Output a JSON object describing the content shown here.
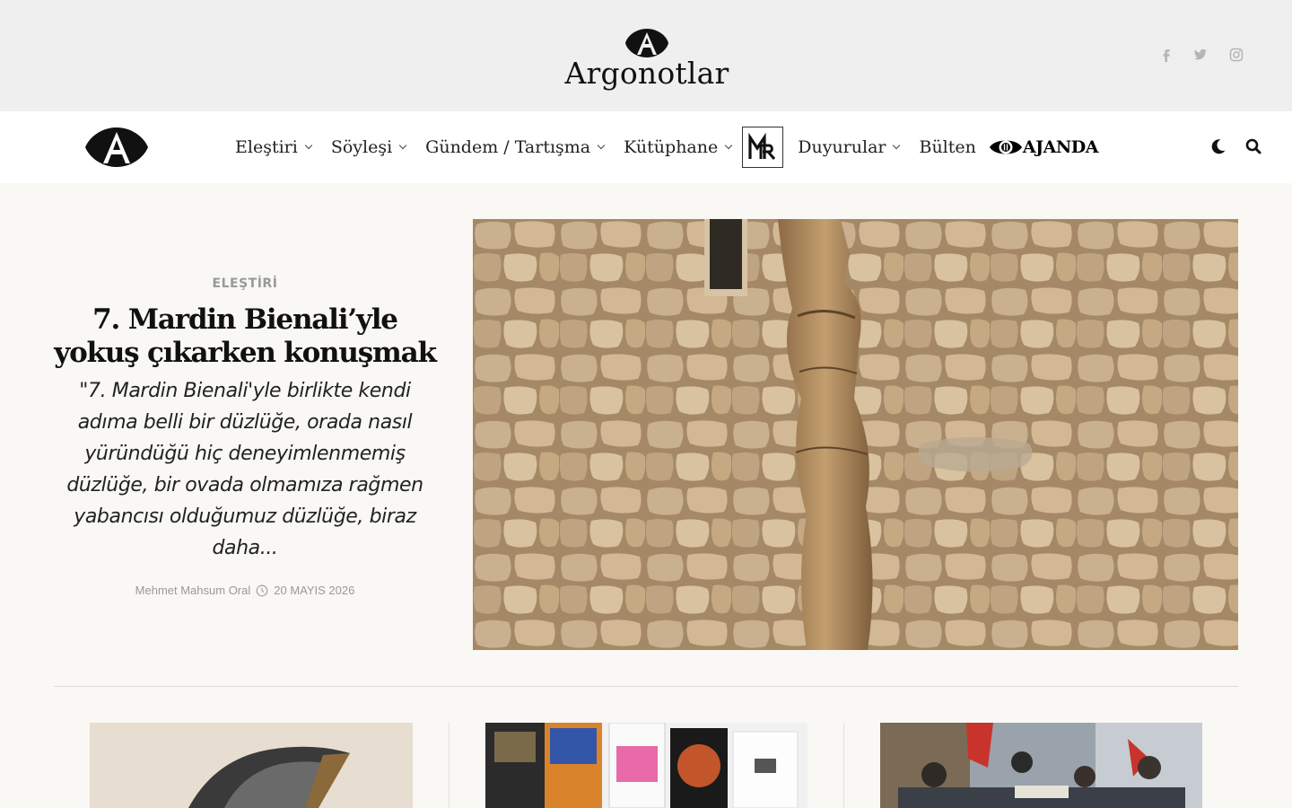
{
  "site": {
    "brand_name": "Argonotlar",
    "social": [
      "facebook-icon",
      "twitter-icon",
      "instagram-icon"
    ]
  },
  "nav": {
    "items": [
      {
        "label": "Eleştiri",
        "dropdown": true
      },
      {
        "label": "Söyleşi",
        "dropdown": true
      },
      {
        "label": "Gündem / Tartışma",
        "dropdown": true
      },
      {
        "label": "Kütüphane",
        "dropdown": true
      },
      {
        "label": "Duyurular",
        "dropdown": true
      },
      {
        "label": "Bülten",
        "dropdown": false
      }
    ],
    "ajanda_label": "AJANDA",
    "right_icons": [
      "moon-icon",
      "search-icon"
    ]
  },
  "hero": {
    "category": "ELEŞTİRİ",
    "title": "7. Mardin Bienali’yle yokuş çıkarken konuşmak",
    "excerpt": "\"7. Mardin Bienali'yle birlikte kendi adıma belli bir düzlüğe, orada nasıl yüründüğü hiç deneyimlenmemiş düzlüğe, bir ovada olmamıza rağmen yabancısı olduğumuz düzlüğe, biraz daha...",
    "author": "Mehmet Mahsum Oral",
    "date": "20 MAYIS 2026"
  },
  "colors": {
    "top_banner_bg": "#efefef",
    "page_bg": "#f9f8f5",
    "category_gray": "#999999"
  }
}
